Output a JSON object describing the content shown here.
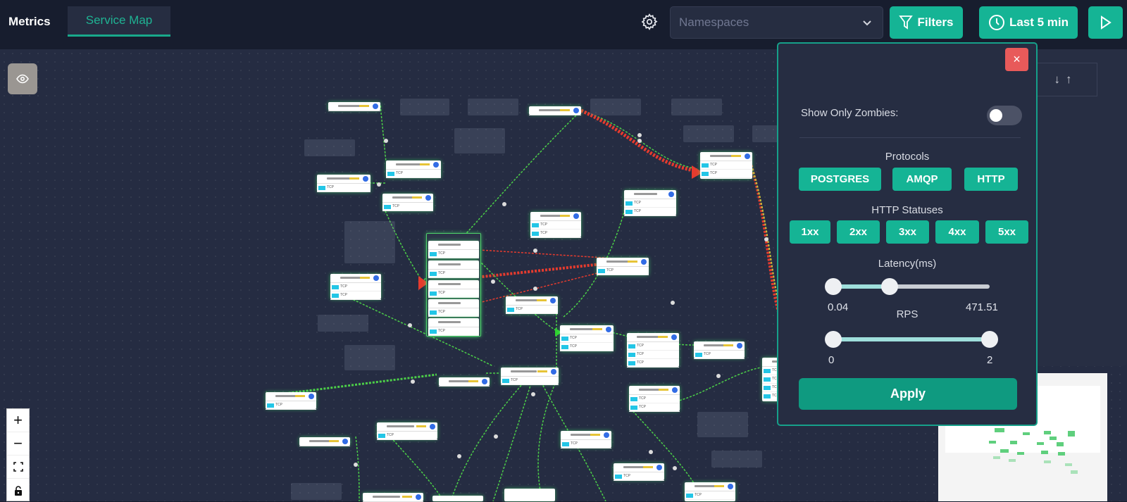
{
  "header": {
    "tabs": [
      {
        "label": "Metrics",
        "active": false
      },
      {
        "label": "Service Map",
        "active": true
      }
    ],
    "namespaces_placeholder": "Namespaces",
    "filters_label": "Filters",
    "time_range_label": "Last 5 min",
    "colors": {
      "accent": "#15b495",
      "active_tab_text": "#1fb393"
    }
  },
  "map": {
    "port_protocol_label": "TCP",
    "controls": [
      "zoom-in",
      "zoom-out",
      "fit-view",
      "toggle-lock"
    ]
  },
  "side_panel": {
    "sort_down": "↓",
    "sort_up": "↑"
  },
  "filter_panel": {
    "close_label": "×",
    "show_only_zombies_label": "Show Only Zombies:",
    "show_only_zombies_value": false,
    "protocols_heading": "Protocols",
    "protocols": [
      "POSTGRES",
      "AMQP",
      "HTTP"
    ],
    "http_statuses_heading": "HTTP Statuses",
    "http_statuses": [
      "1xx",
      "2xx",
      "3xx",
      "4xx",
      "5xx"
    ],
    "latency_heading": "Latency(ms)",
    "latency_min": "0.04",
    "latency_max": "471.51",
    "latency_selected_fraction": [
      0.0,
      0.36
    ],
    "rps_heading": "RPS",
    "rps_min": "0",
    "rps_max": "2",
    "rps_selected_fraction": [
      0.0,
      1.0
    ],
    "apply_label": "Apply",
    "colors": {
      "close": "#e85a5a",
      "chip": "#15b495",
      "apply": "#0f9a80"
    }
  }
}
